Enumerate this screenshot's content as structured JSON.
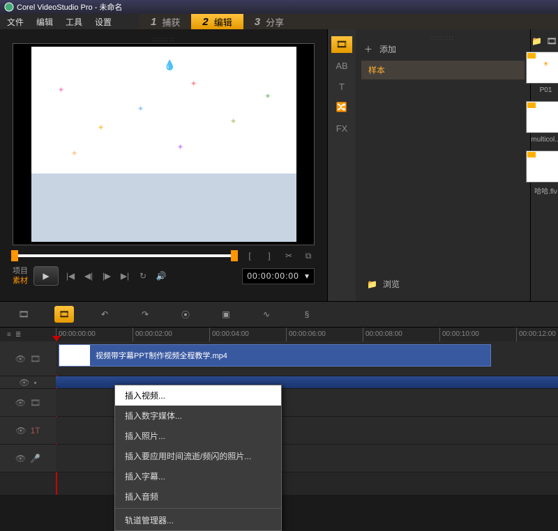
{
  "title": "Corel VideoStudio Pro - 未命名",
  "menu": {
    "file": "文件",
    "edit": "编辑",
    "tools": "工具",
    "settings": "设置"
  },
  "steps": [
    {
      "num": "1",
      "label": "捕获"
    },
    {
      "num": "2",
      "label": "编辑"
    },
    {
      "num": "3",
      "label": "分享"
    }
  ],
  "preview": {
    "mode_project": "项目",
    "mode_clip": "素材",
    "timecode": "00:00:00:00"
  },
  "library": {
    "add": "添加",
    "category": "样本",
    "browse": "浏览",
    "icons": [
      "media",
      "AB",
      "T",
      "transition",
      "FX"
    ],
    "items": [
      {
        "name": "P01"
      },
      {
        "name": "multicol..."
      },
      {
        "name": "哈哈.flv",
        "type": "flv"
      }
    ]
  },
  "ruler": [
    "00:00:00:00",
    "00:00:02:00",
    "00:00:04:00",
    "00:00:06:00",
    "00:00:08:00",
    "00:00:10:00",
    "00:00:12:00"
  ],
  "clip_name": "视频带字幕PPT制作视频全程教学.mp4",
  "track_labels": {
    "overlay": "1T"
  },
  "context": [
    {
      "label": "插入视频...",
      "hl": true
    },
    {
      "label": "插入数字媒体..."
    },
    {
      "label": "插入照片..."
    },
    {
      "label": "插入要应用时间流逝/频闪的照片..."
    },
    {
      "label": "插入字幕..."
    },
    {
      "label": "插入音频"
    },
    {
      "sep": true
    },
    {
      "label": "轨道管理器..."
    }
  ]
}
